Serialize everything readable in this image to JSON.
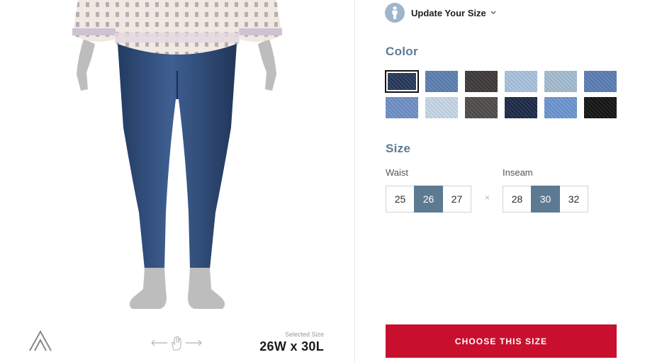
{
  "header": {
    "update_size_label": "Update Your Size",
    "icons": {
      "profile": "person-icon",
      "dropdown": "chevron-down-icon"
    }
  },
  "color": {
    "title": "Color",
    "selected_index": 0,
    "swatches": [
      {
        "hex": "#26385a"
      },
      {
        "hex": "#5b7fb0"
      },
      {
        "hex": "#3d3a39"
      },
      {
        "hex": "#a8c1dc"
      },
      {
        "hex": "#a3bccf"
      },
      {
        "hex": "#5a7db4"
      },
      {
        "hex": "#6f8fc6"
      },
      {
        "hex": "#c6d6e6"
      },
      {
        "hex": "#4e4c4a"
      },
      {
        "hex": "#1c2a48"
      },
      {
        "hex": "#6b95d0"
      },
      {
        "hex": "#141414"
      }
    ]
  },
  "size": {
    "title": "Size",
    "waist_label": "Waist",
    "inseam_label": "Inseam",
    "separator": "×",
    "waist_options": [
      "25",
      "26",
      "27"
    ],
    "waist_selected": "26",
    "inseam_options": [
      "28",
      "30",
      "32"
    ],
    "inseam_selected": "30"
  },
  "selected_size": {
    "label": "Selected Size",
    "value": "26W x 30L"
  },
  "cta": {
    "label": "CHOOSE THIS SIZE",
    "color": "#c8102e"
  },
  "colors": {
    "accent": "#5d7a93",
    "title": "#5c7a93"
  },
  "icons": {
    "logo": "brand-logo-icon",
    "rotate": "hand-rotate-icon"
  }
}
